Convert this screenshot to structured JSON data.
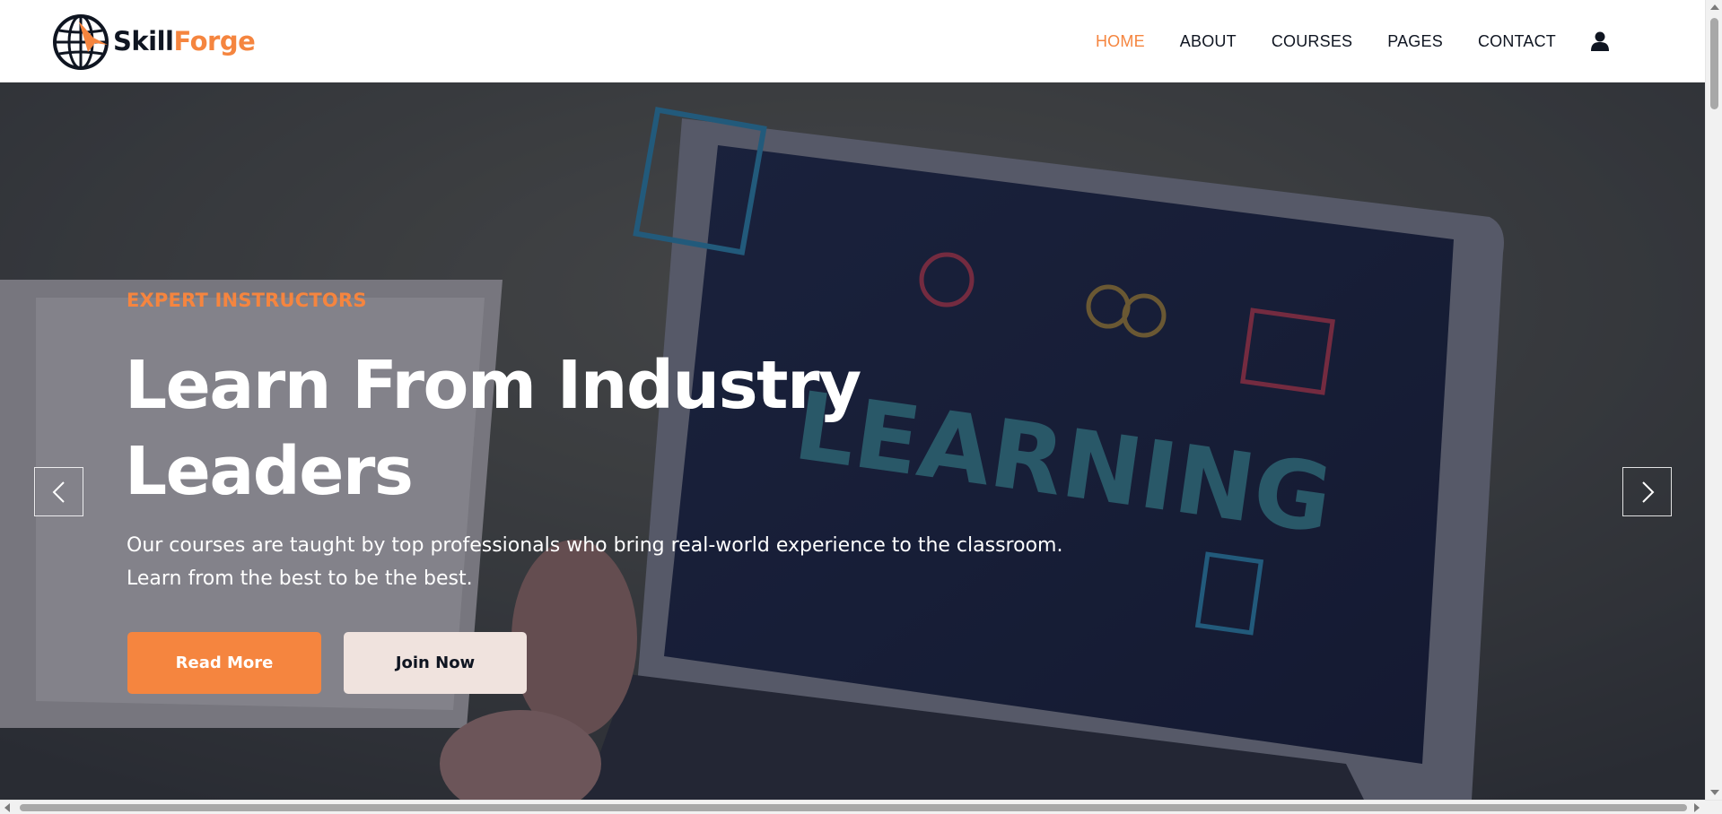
{
  "brand": {
    "name_part1": "Skill",
    "name_part2": "Forge",
    "accent": "#f5853f",
    "dark": "#0f1521"
  },
  "nav": {
    "items": [
      {
        "label": "HOME",
        "active": true
      },
      {
        "label": "ABOUT",
        "active": false
      },
      {
        "label": "COURSES",
        "active": false
      },
      {
        "label": "PAGES",
        "active": false
      },
      {
        "label": "CONTACT",
        "active": false
      }
    ],
    "user_icon": "user-icon"
  },
  "hero": {
    "eyebrow": "EXPERT INSTRUCTORS",
    "headline_line1": "Learn From Industry",
    "headline_line2": "Leaders",
    "lead_line1": "Our courses are taught by top professionals who bring real-world experience to the classroom.",
    "lead_line2": "Learn from the best to be the best.",
    "primary_button": "Read More",
    "secondary_button": "Join Now",
    "screen_word": "LEARNING",
    "prev_icon": "chevron-left-icon",
    "next_icon": "chevron-right-icon"
  }
}
